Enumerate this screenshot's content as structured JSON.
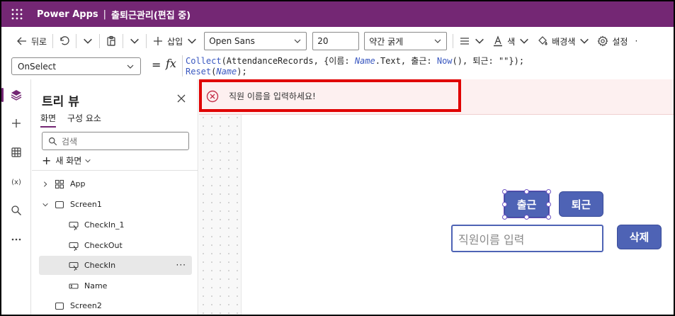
{
  "titlebar": {
    "app_name": "Power Apps",
    "separator": "|",
    "doc_title": "출퇴근관리(편집 중)"
  },
  "cmdbar": {
    "back_label": "뒤로",
    "insert_label": "삽입",
    "font_family": "Open Sans",
    "font_size": "20",
    "font_weight": "약간 굵게",
    "color_label": "색",
    "fill_label": "배경색",
    "settings_label": "설정"
  },
  "formulabar": {
    "property": "OnSelect",
    "equals": "=",
    "fx": "fx",
    "line1": {
      "fn_collect": "Collect",
      "t1": "(AttendanceRecords, {이름: ",
      "var_name": "Name",
      "t2": ".Text, 출근: ",
      "fn_now": "Now",
      "t3": "(), 퇴근: \"\"});"
    },
    "line2": {
      "fn_reset": "Reset",
      "t1": "(",
      "var_name": "Name",
      "t2": ");"
    }
  },
  "treeview": {
    "title": "트리 뷰",
    "tab_screens": "화면",
    "tab_components": "구성 요소",
    "search_placeholder": "검색",
    "new_screen": "새 화면",
    "items": [
      {
        "label": "App"
      },
      {
        "label": "Screen1"
      },
      {
        "label": "CheckIn_1"
      },
      {
        "label": "CheckOut"
      },
      {
        "label": "CheckIn"
      },
      {
        "label": "Name"
      },
      {
        "label": "Screen2"
      }
    ]
  },
  "canvas": {
    "error_message": "직원 이름을 입력하세요!",
    "checkin_label": "출근",
    "checkout_label": "퇴근",
    "delete_label": "삭제",
    "name_placeholder": "직원이름 입력"
  },
  "colors": {
    "brand": "#742774",
    "button": "#4e63b5",
    "error_outline": "#e00000"
  }
}
